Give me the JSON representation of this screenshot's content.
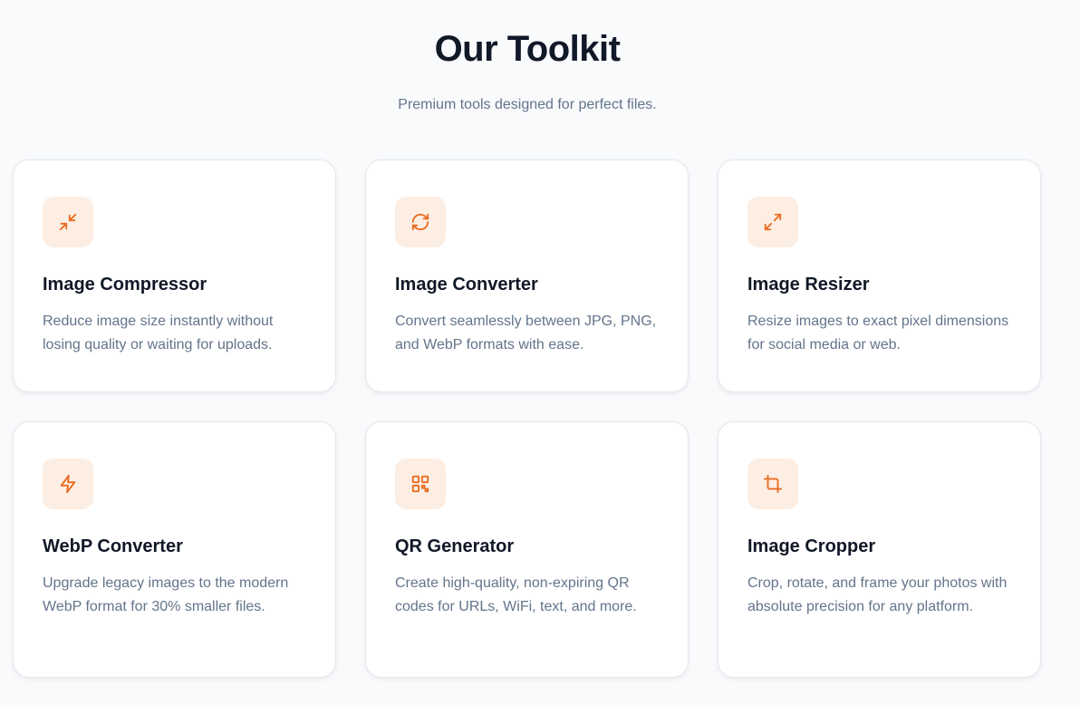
{
  "header": {
    "title": "Our Toolkit",
    "subtitle": "Premium tools designed for perfect files."
  },
  "colors": {
    "accent": "#ea6a1f",
    "icon_background": "#fdeee3",
    "background": "#f8fafc"
  },
  "tools": [
    {
      "icon": "compress-arrows-icon",
      "title": "Image Compressor",
      "description": "Reduce image size instantly without losing quality or waiting for uploads."
    },
    {
      "icon": "refresh-cycle-icon",
      "title": "Image Converter",
      "description": "Convert seamlessly between JPG, PNG, and WebP formats with ease."
    },
    {
      "icon": "expand-arrows-icon",
      "title": "Image Resizer",
      "description": "Resize images to exact pixel dimensions for social media or web."
    },
    {
      "icon": "lightning-bolt-icon",
      "title": "WebP Converter",
      "description": "Upgrade legacy images to the modern WebP format for 30% smaller files."
    },
    {
      "icon": "qr-code-icon",
      "title": "QR Generator",
      "description": "Create high-quality, non-expiring QR codes for URLs, WiFi, text, and more."
    },
    {
      "icon": "crop-icon",
      "title": "Image Cropper",
      "description": "Crop, rotate, and frame your photos with absolute precision for any platform."
    }
  ]
}
